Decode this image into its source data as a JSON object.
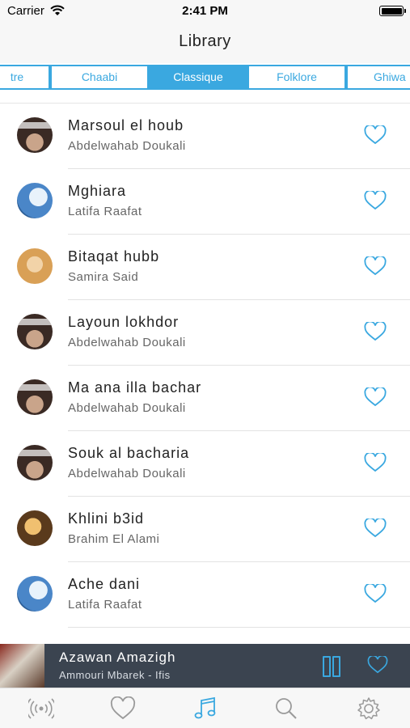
{
  "status": {
    "carrier": "Carrier",
    "time": "2:41 PM"
  },
  "nav": {
    "title": "Library"
  },
  "tabs": [
    {
      "label": "tre",
      "active": false
    },
    {
      "label": "Chaabi",
      "active": false
    },
    {
      "label": "Classique",
      "active": true
    },
    {
      "label": "Folklore",
      "active": false
    },
    {
      "label": "Ghiwa",
      "active": false
    }
  ],
  "songs": [
    {
      "title": "Marsoul el houb",
      "artist": "Abdelwahab Doukali",
      "avatar": "doukali-cover"
    },
    {
      "title": "Mghiara",
      "artist": "Latifa Raafat",
      "avatar": "latifa-cover"
    },
    {
      "title": "Bitaqat hubb",
      "artist": "Samira Said",
      "avatar": "samira-cover"
    },
    {
      "title": "Layoun lokhdor",
      "artist": "Abdelwahab Doukali",
      "avatar": "doukali-cover"
    },
    {
      "title": "Ma ana illa bachar",
      "artist": "Abdelwahab Doukali",
      "avatar": "doukali-cover"
    },
    {
      "title": "Souk al bacharia",
      "artist": "Abdelwahab Doukali",
      "avatar": "doukali-cover"
    },
    {
      "title": "Khlini b3id",
      "artist": "Brahim El Alami",
      "avatar": "brahim-cover"
    },
    {
      "title": "Ache dani",
      "artist": "Latifa Raafat",
      "avatar": "latifa-cover"
    }
  ],
  "player": {
    "title": "Azawan Amazigh",
    "subtitle": "Ammouri Mbarek - Ifis"
  },
  "tabbar": [
    {
      "icon": "radio-icon",
      "active": false
    },
    {
      "icon": "heart-icon",
      "active": false
    },
    {
      "icon": "music-note-icon",
      "active": true
    },
    {
      "icon": "search-icon",
      "active": false
    },
    {
      "icon": "gear-icon",
      "active": false
    }
  ],
  "colors": {
    "accent": "#3aa8e0",
    "player_bg": "#3b4450",
    "tabbar_inactive": "#9a9a9a"
  }
}
